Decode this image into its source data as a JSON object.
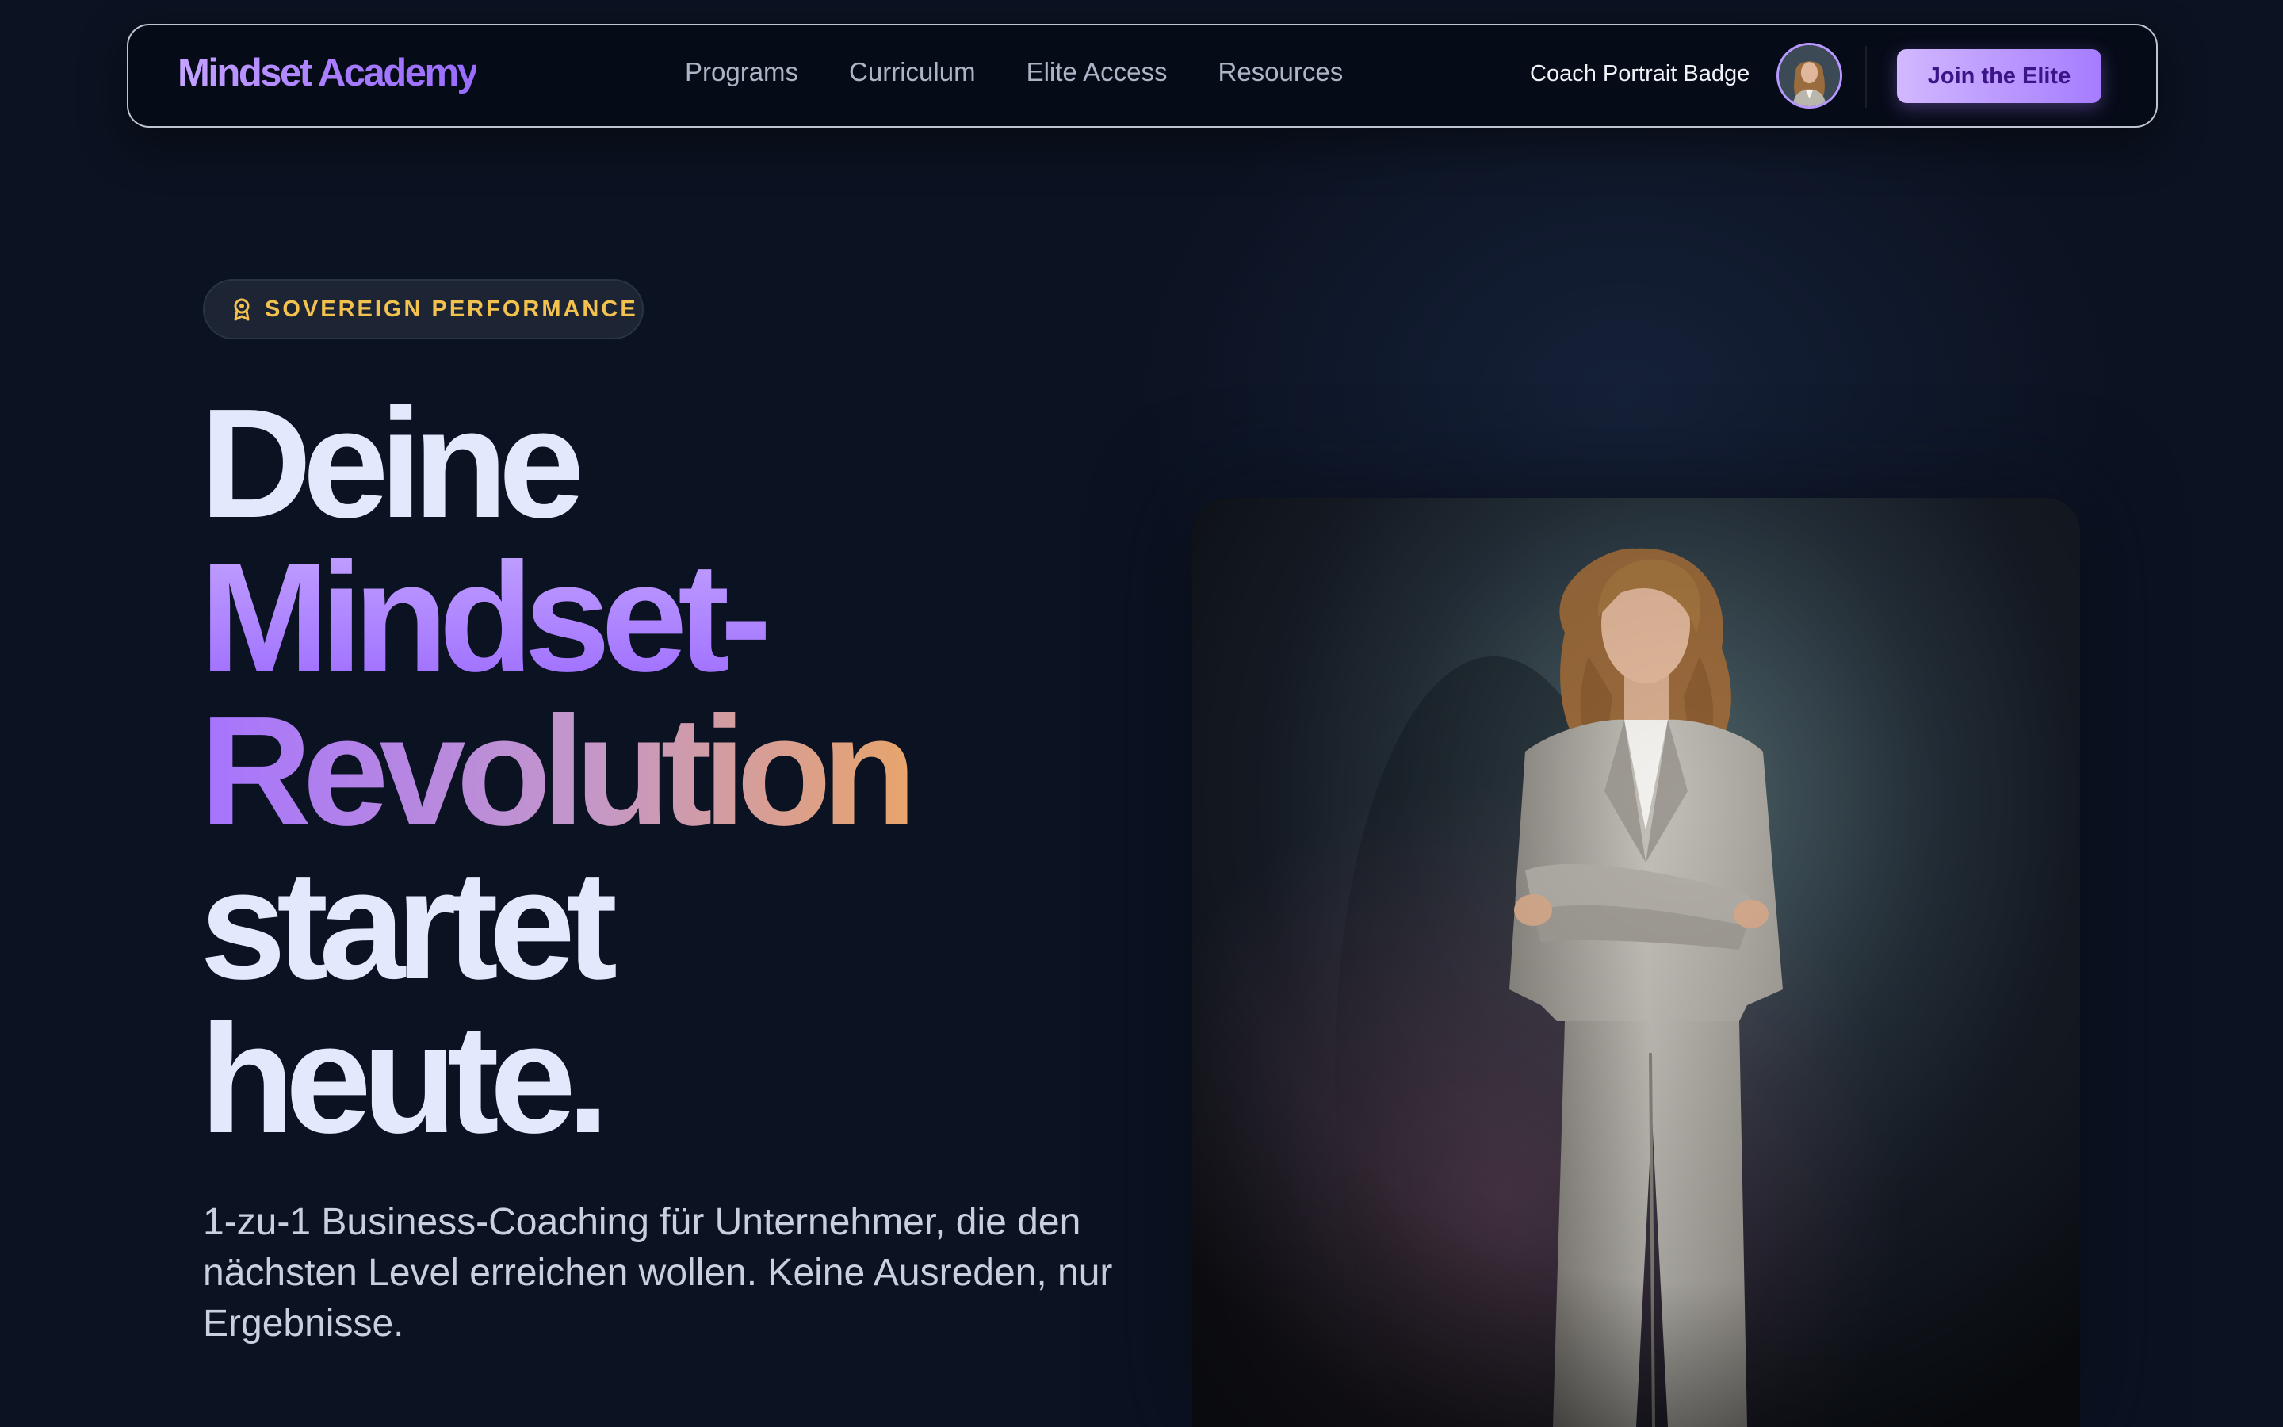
{
  "nav": {
    "logo": "Mindset Academy",
    "links": [
      "Programs",
      "Curriculum",
      "Elite Access",
      "Resources"
    ],
    "coach_label": "Coach Portrait Badge",
    "avatar_icon": "coach-avatar",
    "cta_label": "Join the Elite"
  },
  "hero": {
    "badge_icon": "award-ribbon-icon",
    "badge_text": "SOVEREIGN PERFORMANCE",
    "headline": {
      "line1": "Deine",
      "line2": "Mindset-",
      "line3": "Revolution",
      "line4": "startet",
      "line5": "heute."
    },
    "subtext": "1-zu-1 Business-Coaching für Unternehmer, die den nächsten Level erreichen wollen. Keine Ausreden, nur Ergebnisse.",
    "image": "coach-portrait-photo"
  },
  "colors": {
    "background": "#0b1221",
    "accent_purple": "#a77bff",
    "accent_gold": "#f2c14e",
    "headline_text": "#e3e8fc"
  }
}
